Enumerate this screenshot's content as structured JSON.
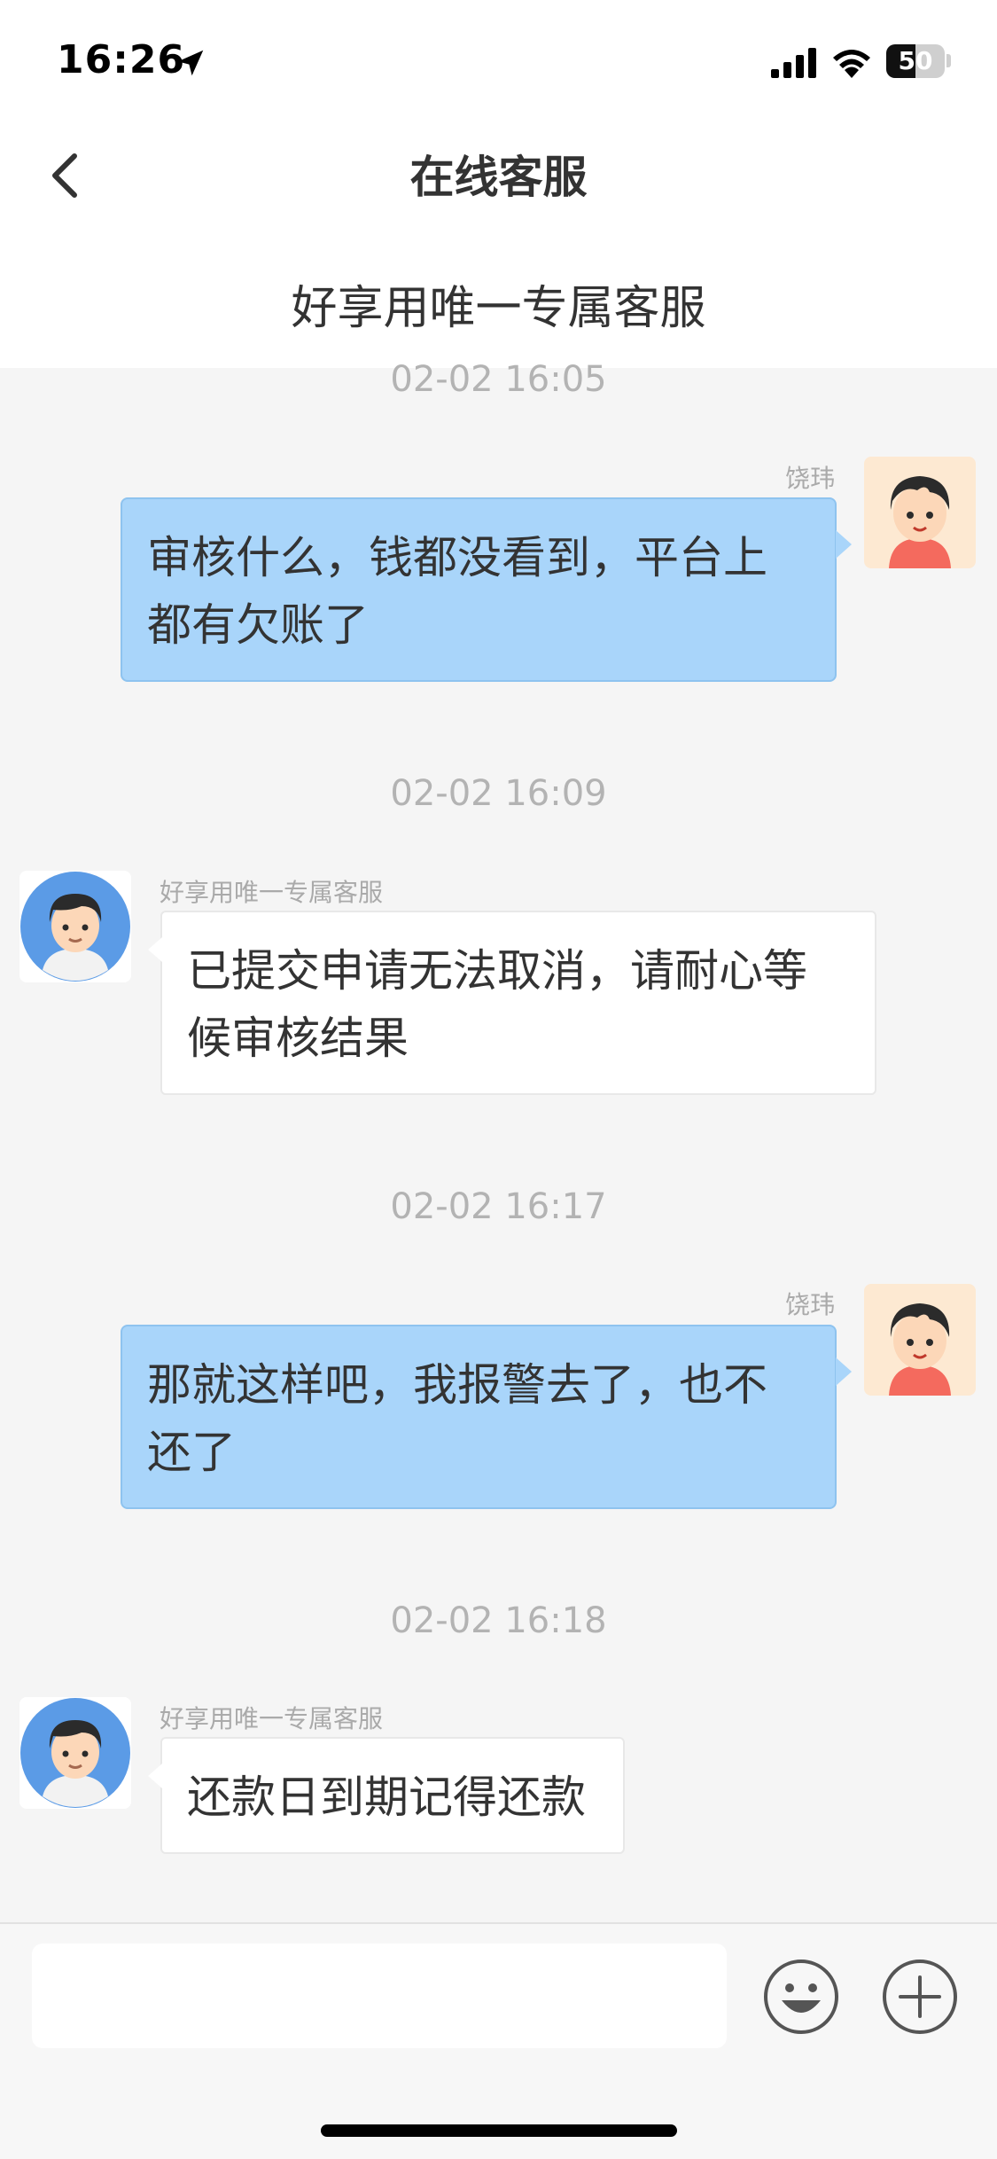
{
  "status_bar": {
    "time": "16:26",
    "battery_level": "50",
    "icons": [
      "location-arrow-icon",
      "signal-icon",
      "wifi-icon",
      "battery-icon"
    ]
  },
  "header": {
    "title": "在线客服",
    "subtitle": "好享用唯一专属客服",
    "back_icon": "chevron-left-icon"
  },
  "messages": [
    {
      "timestamp": "02-02 16:05",
      "sender": "饶玮",
      "side": "right",
      "lines": [
        "审核什么，钱都没看到，平台上",
        "都有欠账了"
      ]
    },
    {
      "timestamp": "02-02 16:09",
      "sender": "好享用唯一专属客服",
      "side": "left",
      "lines": [
        "已提交申请无法取消，请耐心等",
        "候审核结果"
      ]
    },
    {
      "timestamp": "02-02 16:17",
      "sender": "饶玮",
      "side": "right",
      "lines": [
        "那就这样吧，我报警去了，也不",
        "还了"
      ]
    },
    {
      "timestamp": "02-02 16:18",
      "sender": "好享用唯一专属客服",
      "side": "left",
      "lines": [
        "还款日到期记得还款"
      ]
    }
  ],
  "input": {
    "value": "",
    "placeholder": "",
    "emoji_icon": "emoji-smile-icon",
    "plus_icon": "plus-circle-icon"
  },
  "colors": {
    "my_bubble": "#a9d5fa",
    "cs_bubble": "#ffffff",
    "background": "#f5f5f5",
    "timestamp": "#b3b3b3"
  }
}
